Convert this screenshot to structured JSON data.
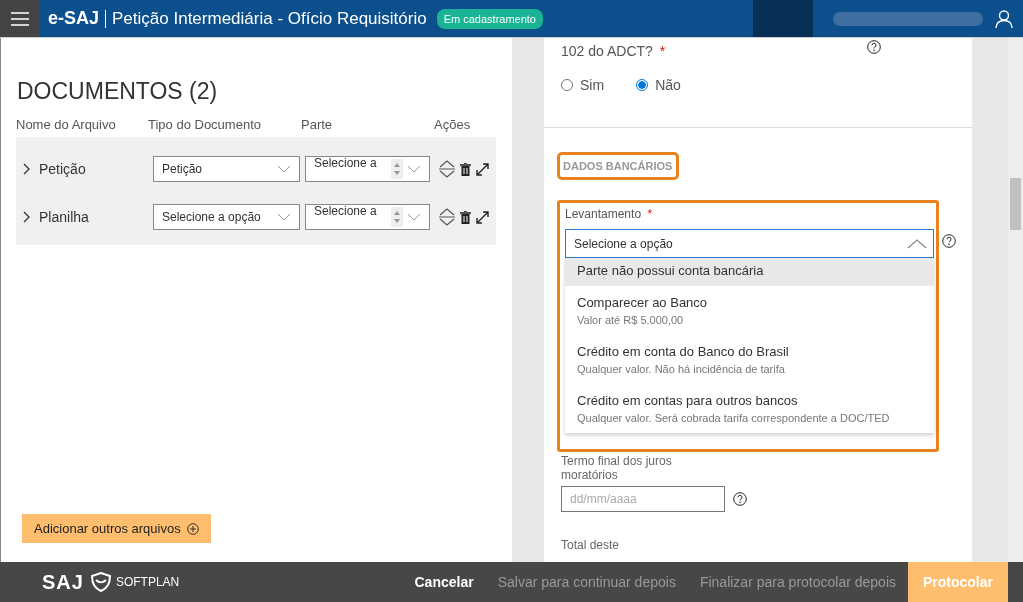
{
  "header": {
    "brand": "e-SAJ",
    "title": "Petição Intermediária - Ofício Requisitório",
    "status_badge": "Em cadastramento"
  },
  "documents": {
    "title": "DOCUMENTOS (2)",
    "columns": [
      "Nome do Arquivo",
      "Tipo do Documento",
      "Parte",
      "Ações"
    ],
    "rows": [
      {
        "name": "Petição",
        "type_value": "Petição",
        "part_value": "Selecione a"
      },
      {
        "name": "Planilha",
        "type_value": "Selecione a opção",
        "part_value": "Selecione a"
      }
    ],
    "add_button": "Adicionar outros arquivos"
  },
  "form": {
    "question": "102 do ADCT?",
    "question_required_mark": "*",
    "radios": [
      {
        "label": "Sim",
        "selected": false
      },
      {
        "label": "Não",
        "selected": true
      }
    ],
    "section_title": "DADOS BANCÁRIOS",
    "levantamento": {
      "label": "Levantamento",
      "required_mark": "*",
      "value": "Selecione a opção",
      "expanded": true,
      "options": [
        {
          "label": "Parte não possui conta bancária",
          "selected": true
        },
        {
          "label": "Comparecer ao Banco",
          "hint": "Valor até R$ 5.000,00",
          "selected": false
        },
        {
          "label": "Crédito em conta do Banco do Brasil",
          "hint": "Qualquer valor. Não há incidência de tarifa",
          "selected": false
        },
        {
          "label": "Crédito em contas para outros bancos",
          "hint": "Qualquer valor. Será cobrada tarifa correspondente a DOC/TED",
          "selected": false
        }
      ]
    },
    "termo": {
      "label": "Termo final dos juros moratórios",
      "placeholder": "dd/mm/aaaa"
    },
    "total_label": "Total deste"
  },
  "footer": {
    "logo": "SAJ",
    "brand": "SOFTPLAN",
    "buttons": [
      {
        "label": "Cancelar",
        "kind": "secondary",
        "disabled": false
      },
      {
        "label": "Salvar para continuar depois",
        "kind": "secondary",
        "disabled": true
      },
      {
        "label": "Finalizar para protocolar depois",
        "kind": "secondary",
        "disabled": true
      },
      {
        "label": "Protocolar",
        "kind": "primary",
        "disabled": false
      }
    ]
  }
}
